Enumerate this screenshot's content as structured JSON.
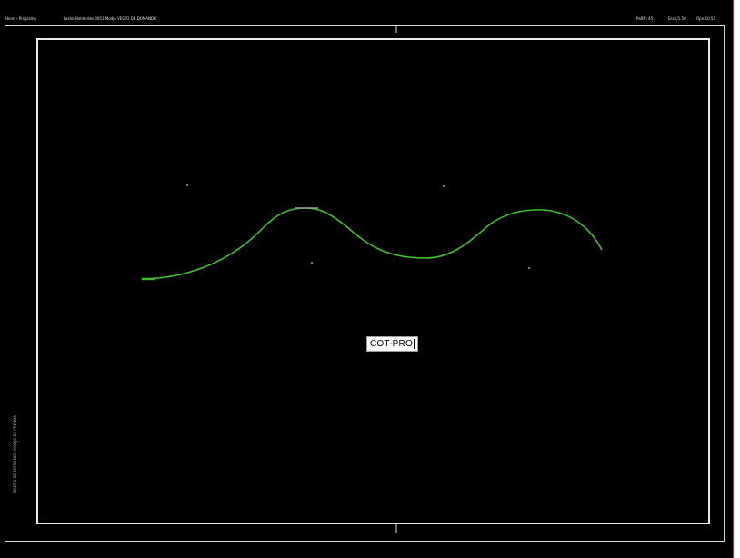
{
  "topbar": {
    "left_label": "Henn › Programa",
    "file_label": "Fashn Holderdes 3051  Modjo VESTO DE DOMANDO",
    "right_1": "PaRN: 45",
    "right_2": "Esc1/1.50",
    "right_3": "Opn:10.55"
  },
  "frame": {
    "side_text": "DISEÑO DE PATRONES: MODJO DE PRENDA"
  },
  "command": {
    "value": "COT-PRO"
  },
  "colors": {
    "background": "#000000",
    "curve": "#3fbf2f",
    "frame": "#e8e8e8"
  }
}
